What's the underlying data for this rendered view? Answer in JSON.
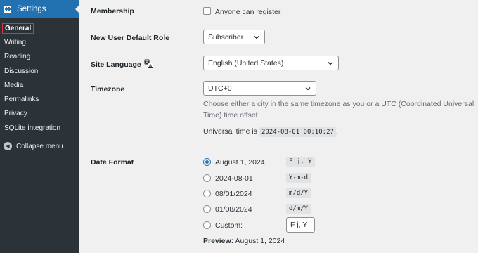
{
  "sidebar": {
    "header": "Settings",
    "items": [
      {
        "label": "General",
        "current": true
      },
      {
        "label": "Writing"
      },
      {
        "label": "Reading"
      },
      {
        "label": "Discussion"
      },
      {
        "label": "Media"
      },
      {
        "label": "Permalinks"
      },
      {
        "label": "Privacy"
      },
      {
        "label": "SQLite integration"
      }
    ],
    "collapse": "Collapse menu"
  },
  "membership": {
    "label": "Membership",
    "checkbox_label": "Anyone can register",
    "checked": false
  },
  "default_role": {
    "label": "New User Default Role",
    "value": "Subscriber"
  },
  "site_language": {
    "label": "Site Language",
    "value": "English (United States)"
  },
  "timezone": {
    "label": "Timezone",
    "value": "UTC+0",
    "description": "Choose either a city in the same timezone as you or a UTC (Coordinated Universal Time) time offset.",
    "universal_prefix": "Universal time is",
    "universal_time": "2024-08-01 00:10:27",
    "universal_suffix": "."
  },
  "date_format": {
    "label": "Date Format",
    "options": [
      {
        "label": "August 1, 2024",
        "code": "F j, Y",
        "checked": true
      },
      {
        "label": "2024-08-01",
        "code": "Y-m-d"
      },
      {
        "label": "08/01/2024",
        "code": "m/d/Y"
      },
      {
        "label": "01/08/2024",
        "code": "d/m/Y"
      },
      {
        "label": "Custom:",
        "code": "F j, Y"
      }
    ],
    "preview_label": "Preview:",
    "preview_value": "August 1, 2024"
  }
}
